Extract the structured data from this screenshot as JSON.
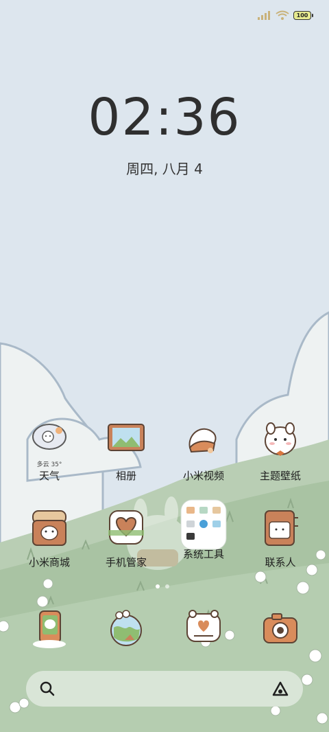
{
  "status": {
    "battery_level": "100",
    "signal_icon": "signal-icon",
    "wifi_icon": "wifi-icon"
  },
  "clock": {
    "time": "02:36",
    "date": "周四, 八月 4"
  },
  "apps_row1": [
    {
      "label": "天气",
      "extra": "多云 35°",
      "icon": "weather-icon"
    },
    {
      "label": "相册",
      "icon": "gallery-icon"
    },
    {
      "label": "小米视频",
      "icon": "video-icon"
    },
    {
      "label": "主题壁纸",
      "icon": "themes-icon"
    }
  ],
  "apps_row2": [
    {
      "label": "小米商城",
      "icon": "store-icon"
    },
    {
      "label": "手机管家",
      "icon": "security-icon"
    },
    {
      "label": "系统工具",
      "icon": "tools-folder-icon"
    },
    {
      "label": "联系人",
      "icon": "contacts-icon"
    }
  ],
  "dock": [
    {
      "icon": "phone-icon"
    },
    {
      "icon": "browser-icon"
    },
    {
      "icon": "messages-icon"
    },
    {
      "icon": "camera-icon"
    }
  ],
  "pages": {
    "count": 2,
    "active": 1
  },
  "search": {
    "search_icon": "search-icon",
    "assistant_icon": "assistant-icon"
  }
}
